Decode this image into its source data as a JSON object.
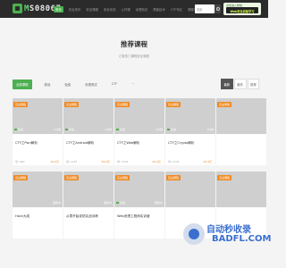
{
  "header": {
    "logo_prefix": "M",
    "logo_rest": "S08067",
    "nav": [
      "首页",
      "安全资讯",
      "安全课程",
      "安全动态",
      "公开课",
      "渗透测试",
      "黑客技术",
      "CTF专区",
      "课程中心",
      "MS08",
      "更多"
    ],
    "search_placeholder": "搜索",
    "badge_top": "点击进入体验",
    "badge_main": "Web安全初级学习"
  },
  "page": {
    "title": "推荐课程",
    "subtitle": "汇聚热门课程安全课程"
  },
  "filters": [
    "全部课程",
    "新品",
    "免费",
    "渗透测试",
    "CTF",
    "···"
  ],
  "sort": [
    "最新",
    "最热",
    "推荐"
  ],
  "courses": [
    {
      "tag": "实战课程",
      "lab": "实验",
      "duration": "1分钟",
      "title": "CTF之Pwn解析",
      "meta": "👁 980",
      "price": "39.9元"
    },
    {
      "tag": "实战课程",
      "lab": "实验",
      "duration": "1分钟",
      "title": "CTF之Android解析",
      "meta": "👁 1187",
      "price": "39.9元"
    },
    {
      "tag": "实战课程",
      "lab": "实验",
      "duration": "1分钟",
      "title": "CTF之Web解析",
      "meta": "👁 2105",
      "price": "39.9元"
    },
    {
      "tag": "实战课程",
      "lab": "实验",
      "duration": "1分钟",
      "title": "CTF之Crypto解析",
      "meta": "👁 1203",
      "price": "39.9元"
    },
    {
      "tag": "实战课程",
      "lab": "",
      "duration": "",
      "title": "",
      "meta": "",
      "price": ""
    },
    {
      "tag": "实战课程",
      "lab": "",
      "duration": "更新中",
      "title": "Hack大成",
      "meta": "",
      "price": ""
    },
    {
      "tag": "实战课程",
      "lab": "",
      "duration": "更新中",
      "title": "从零开始攻防实战训练",
      "meta": "",
      "price": ""
    },
    {
      "tag": "实战课程",
      "lab": "实验",
      "duration": "更新中",
      "title": "Web渗透工程师实训营",
      "meta": "",
      "price": ""
    },
    {
      "tag": "实战课程",
      "lab": "",
      "duration": "",
      "title": "",
      "meta": "",
      "price": ""
    },
    {
      "tag": "实战课程",
      "lab": "",
      "duration": "",
      "title": "",
      "meta": "",
      "price": ""
    }
  ],
  "watermark": {
    "line1": "自动秒收录",
    "line2": "BADFL.COM"
  }
}
